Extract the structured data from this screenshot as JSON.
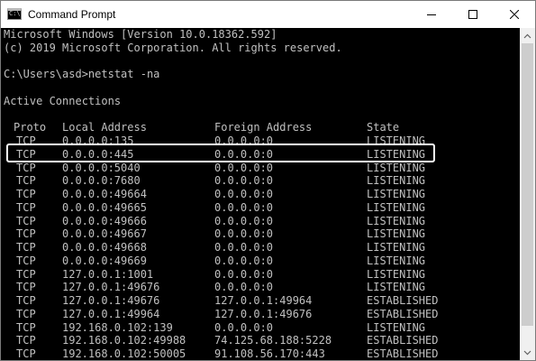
{
  "window": {
    "title": "Command Prompt",
    "icon": "command-prompt-icon",
    "icon_label": "C:\\"
  },
  "controls": {
    "minimize_icon": "minimize-icon",
    "maximize_icon": "maximize-icon",
    "close_icon": "close-icon"
  },
  "console": {
    "header_lines": [
      "Microsoft Windows [Version 10.0.18362.592]",
      "(c) 2019 Microsoft Corporation. All rights reserved."
    ],
    "command": "C:\\Users\\asd>netstat -na",
    "section_title": "Active Connections",
    "columns": {
      "proto": "Proto",
      "local": "Local Address",
      "foreign": "Foreign Address",
      "state": "State"
    },
    "rows": [
      {
        "proto": "TCP",
        "local": "0.0.0.0:135",
        "foreign": "0.0.0.0:0",
        "state": "LISTENING"
      },
      {
        "proto": "TCP",
        "local": "0.0.0.0:445",
        "foreign": "0.0.0.0:0",
        "state": "LISTENING"
      },
      {
        "proto": "TCP",
        "local": "0.0.0.0:5040",
        "foreign": "0.0.0.0:0",
        "state": "LISTENING"
      },
      {
        "proto": "TCP",
        "local": "0.0.0.0:7680",
        "foreign": "0.0.0.0:0",
        "state": "LISTENING"
      },
      {
        "proto": "TCP",
        "local": "0.0.0.0:49664",
        "foreign": "0.0.0.0:0",
        "state": "LISTENING"
      },
      {
        "proto": "TCP",
        "local": "0.0.0.0:49665",
        "foreign": "0.0.0.0:0",
        "state": "LISTENING"
      },
      {
        "proto": "TCP",
        "local": "0.0.0.0:49666",
        "foreign": "0.0.0.0:0",
        "state": "LISTENING"
      },
      {
        "proto": "TCP",
        "local": "0.0.0.0:49667",
        "foreign": "0.0.0.0:0",
        "state": "LISTENING"
      },
      {
        "proto": "TCP",
        "local": "0.0.0.0:49668",
        "foreign": "0.0.0.0:0",
        "state": "LISTENING"
      },
      {
        "proto": "TCP",
        "local": "0.0.0.0:49669",
        "foreign": "0.0.0.0:0",
        "state": "LISTENING"
      },
      {
        "proto": "TCP",
        "local": "127.0.0.1:1001",
        "foreign": "0.0.0.0:0",
        "state": "LISTENING"
      },
      {
        "proto": "TCP",
        "local": "127.0.0.1:49676",
        "foreign": "0.0.0.0:0",
        "state": "LISTENING"
      },
      {
        "proto": "TCP",
        "local": "127.0.0.1:49676",
        "foreign": "127.0.0.1:49964",
        "state": "ESTABLISHED"
      },
      {
        "proto": "TCP",
        "local": "127.0.0.1:49964",
        "foreign": "127.0.0.1:49676",
        "state": "ESTABLISHED"
      },
      {
        "proto": "TCP",
        "local": "192.168.0.102:139",
        "foreign": "0.0.0.0:0",
        "state": "LISTENING"
      },
      {
        "proto": "TCP",
        "local": "192.168.0.102:49988",
        "foreign": "74.125.68.188:5228",
        "state": "ESTABLISHED"
      },
      {
        "proto": "TCP",
        "local": "192.168.0.102:50005",
        "foreign": "91.108.56.170:443",
        "state": "ESTABLISHED"
      }
    ],
    "highlighted_row": 1
  },
  "colors": {
    "console_bg": "#000000",
    "console_text": "#c0c0c0",
    "highlight_border": "#ffffff"
  }
}
